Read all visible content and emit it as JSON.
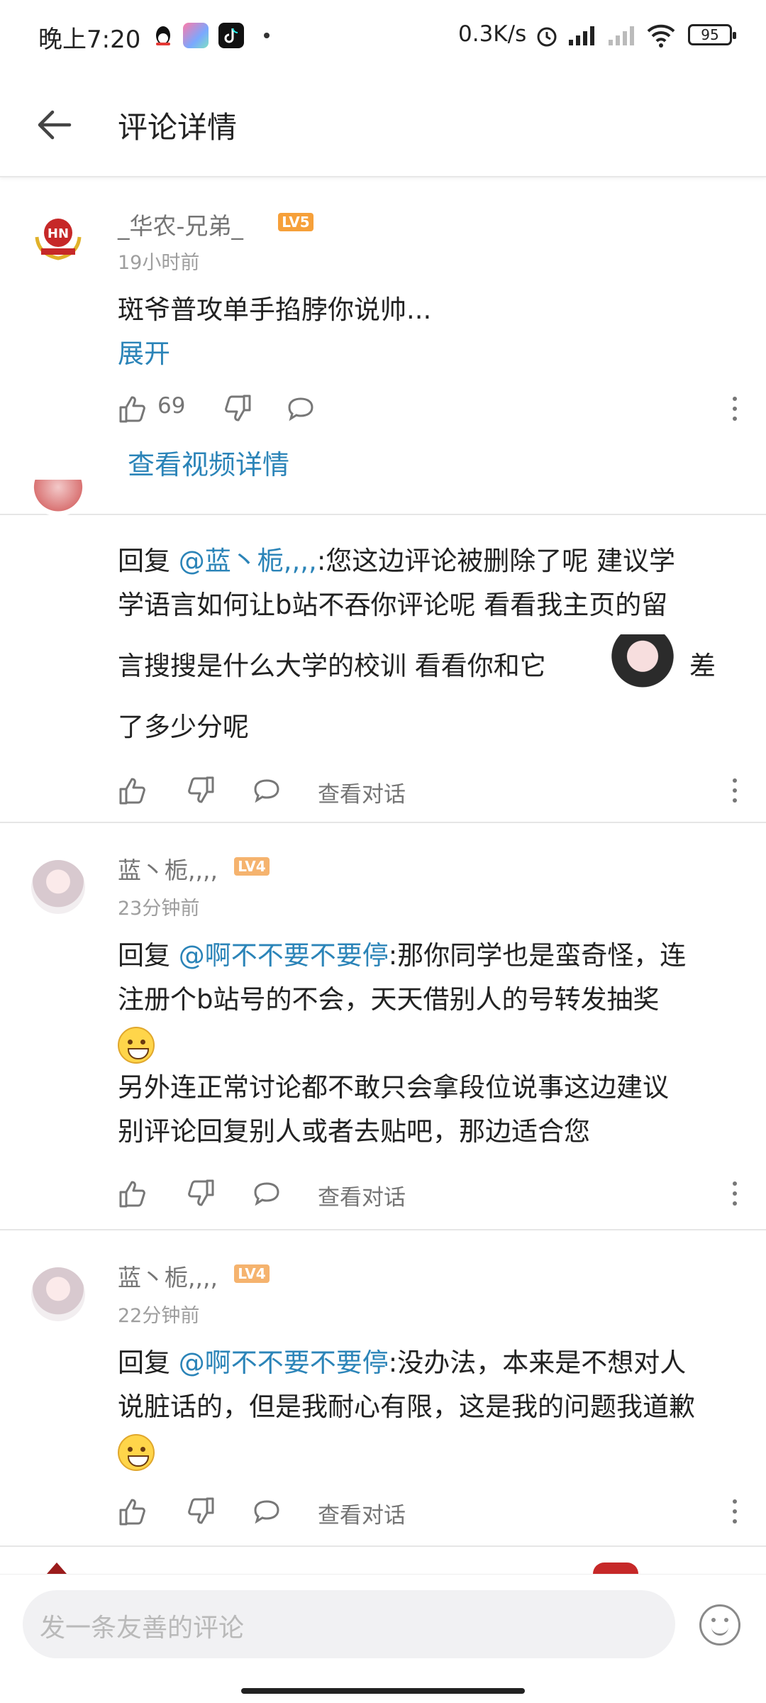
{
  "status_bar": {
    "time": "晚上7:20",
    "net_speed": "0.3K/s",
    "battery": "95"
  },
  "header": {
    "title": "评论详情"
  },
  "main_comment": {
    "username": "_华农-兄弟_",
    "level": "LV5",
    "time": "19小时前",
    "text": "斑爷普攻单手掐脖你说帅...",
    "expand": "展开",
    "likes": "69",
    "video_link": "查看视频详情"
  },
  "replies": [
    {
      "reply_prefix": "回复",
      "mention": "@蓝丶栀,,,,",
      "text_line1": ":您这边评论被删除了呢  建议学",
      "text_line2": "学语言如何让b站不吞你评论呢   看看我主页的留",
      "text_line3": "言搜搜是什么大学的校训   看看你和它",
      "text_line4": "差",
      "text_line5": "了多少分呢",
      "view_conv": "查看对话"
    },
    {
      "username": "蓝丶栀,,,,",
      "level": "LV4",
      "time": "23分钟前",
      "reply_prefix": "回复",
      "mention": "@啊不不要不要停",
      "text_line1": ":那你同学也是蛮奇怪，连",
      "text_line2": "注册个b站号的不会，天天借别人的号转发抽奖",
      "text_line3": "另外连正常讨论都不敢只会拿段位说事这边建议",
      "text_line4": "别评论回复别人或者去贴吧，那边适合您",
      "view_conv": "查看对话"
    },
    {
      "username": "蓝丶栀,,,,",
      "level": "LV4",
      "time": "22分钟前",
      "reply_prefix": "回复",
      "mention": "@啊不不要不要停",
      "text_line1": ":没办法，本来是不想对人",
      "text_line2": "说脏话的，但是我耐心有限，这是我的问题我道歉",
      "view_conv": "查看对话"
    }
  ],
  "input": {
    "placeholder": "发一条友善的评论"
  },
  "colors": {
    "link": "#2b84b8",
    "lv5": "#f6a03a",
    "lv4": "#f5b36e"
  }
}
